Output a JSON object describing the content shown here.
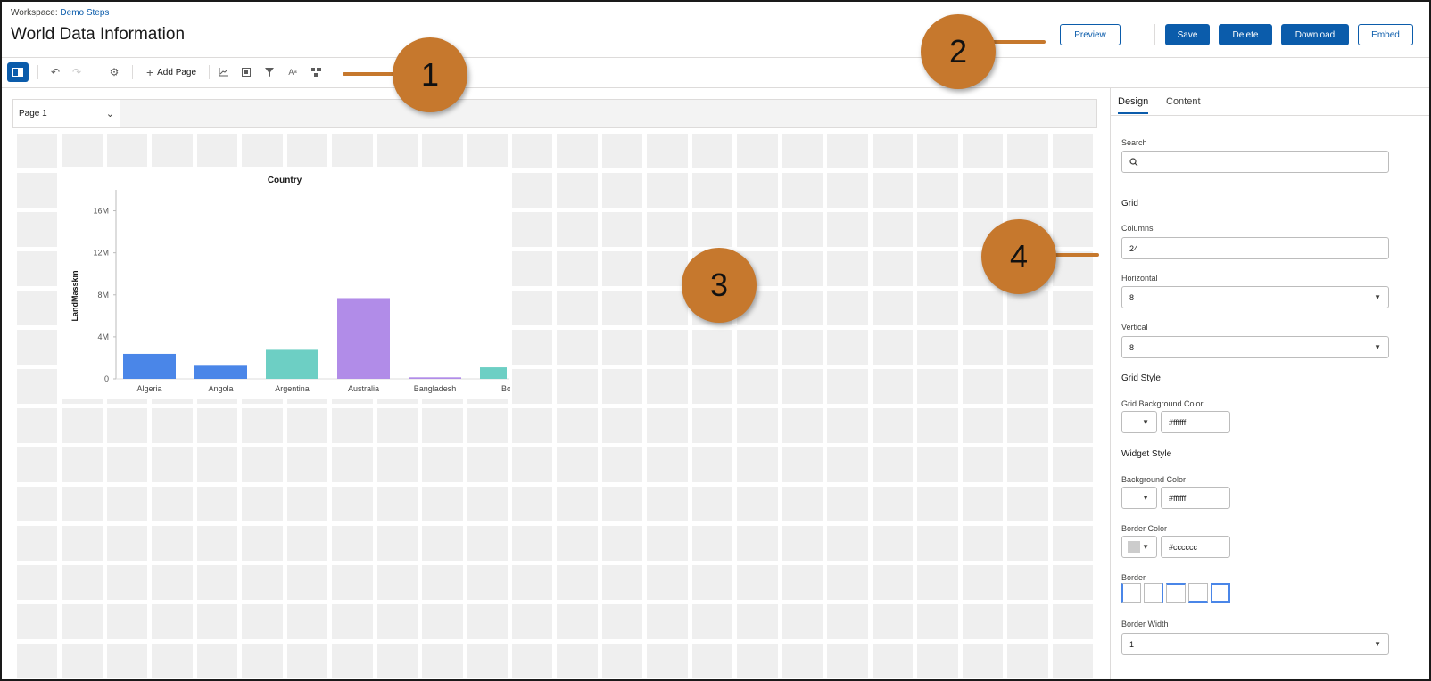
{
  "header": {
    "workspace_prefix": "Workspace:",
    "workspace_name": "Demo Steps",
    "title": "World Data Information",
    "buttons": {
      "preview": "Preview",
      "save": "Save",
      "delete": "Delete",
      "download": "Download",
      "embed": "Embed"
    }
  },
  "toolbar": {
    "add_page": "Add Page",
    "icons": [
      "panel-toggle-icon",
      "undo-icon",
      "redo-icon",
      "settings-icon",
      "add-icon",
      "chart-icon",
      "container-icon",
      "filter-icon",
      "text-icon",
      "layout-icon"
    ]
  },
  "canvas": {
    "page_select": "Page 1",
    "grid_columns": 24,
    "grid_rows": 14
  },
  "chart_data": {
    "type": "bar",
    "title": "Country",
    "ylabel": "LandMasskm",
    "xlabel": "",
    "categories": [
      "Algeria",
      "Angola",
      "Argentina",
      "Australia",
      "Bangladesh",
      "Bo"
    ],
    "values": [
      2381740,
      1246700,
      2766890,
      7686850,
      144000,
      1098580
    ],
    "colors": [
      "#4a86e8",
      "#4a86e8",
      "#6dcfc4",
      "#b18ce8",
      "#b18ce8",
      "#6dcfc4"
    ],
    "yticks": [
      "0",
      "4M",
      "8M",
      "12M",
      "16M"
    ],
    "ylim": [
      0,
      18000000
    ],
    "grid": false
  },
  "panel": {
    "tabs": [
      "Design",
      "Content"
    ],
    "search_label": "Search",
    "grid_section": "Grid",
    "columns_label": "Columns",
    "columns_value": "24",
    "horizontal_label": "Horizontal",
    "horizontal_value": "8",
    "vertical_label": "Vertical",
    "vertical_value": "8",
    "grid_style_section": "Grid Style",
    "grid_bg_label": "Grid Background Color",
    "grid_bg_value": "#ffffff",
    "widget_style_section": "Widget Style",
    "bg_color_label": "Background Color",
    "bg_color_value": "#ffffff",
    "border_color_label": "Border Color",
    "border_color_value": "#cccccc",
    "border_label": "Border",
    "border_width_label": "Border Width",
    "border_width_value": "1"
  },
  "callouts": [
    "1",
    "2",
    "3",
    "4"
  ],
  "accent_color": "#0b5cab",
  "callout_color": "#c6782d"
}
